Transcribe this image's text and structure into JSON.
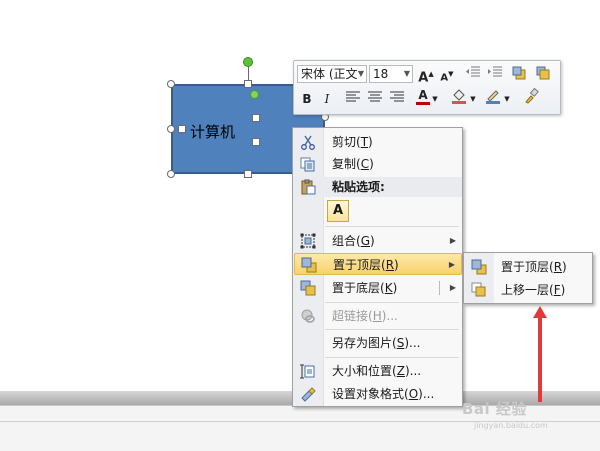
{
  "shape": {
    "text": "计算机",
    "fill_color": "#4f81bd"
  },
  "mini_toolbar": {
    "font_name": "宋体 (正文",
    "font_size": "18",
    "grow_font_glyph": "A",
    "shrink_font_glyph": "A",
    "bold_glyph": "B",
    "italic_glyph": "I",
    "font_color_glyph": "A",
    "font_color": "#c00000"
  },
  "context_menu": {
    "items": [
      {
        "label": "剪切",
        "shortcut": "T",
        "icon": "scissors-icon"
      },
      {
        "label": "复制",
        "shortcut": "C",
        "icon": "copy-icon"
      },
      {
        "label": "粘贴选项:",
        "icon": "paste-icon"
      },
      {
        "label": "组合",
        "shortcut": "G",
        "icon": "group-icon"
      },
      {
        "label": "置于顶层",
        "shortcut": "R",
        "icon": "bring-to-front-icon"
      },
      {
        "label": "置于底层",
        "shortcut": "K",
        "icon": "send-to-back-icon"
      },
      {
        "label": "超链接",
        "shortcut": "H",
        "suffix": "...",
        "icon": "hyperlink-icon"
      },
      {
        "label": "另存为图片",
        "shortcut": "S",
        "suffix": "...",
        "icon": ""
      },
      {
        "label": "大小和位置",
        "shortcut": "Z",
        "suffix": "...",
        "icon": "size-position-icon"
      },
      {
        "label": "设置对象格式",
        "shortcut": "O",
        "suffix": "...",
        "icon": "format-object-icon"
      }
    ],
    "paste_option_glyph": "A"
  },
  "submenu": {
    "items": [
      {
        "label": "置于顶层",
        "shortcut": "R",
        "icon": "bring-to-front-icon"
      },
      {
        "label": "上移一层",
        "shortcut": "F",
        "icon": "bring-forward-icon"
      }
    ]
  },
  "annotation": {
    "arrow_color": "#e03b3b"
  },
  "watermark": {
    "brand": "Bai 经验",
    "url": "jingyan.baidu.com"
  }
}
